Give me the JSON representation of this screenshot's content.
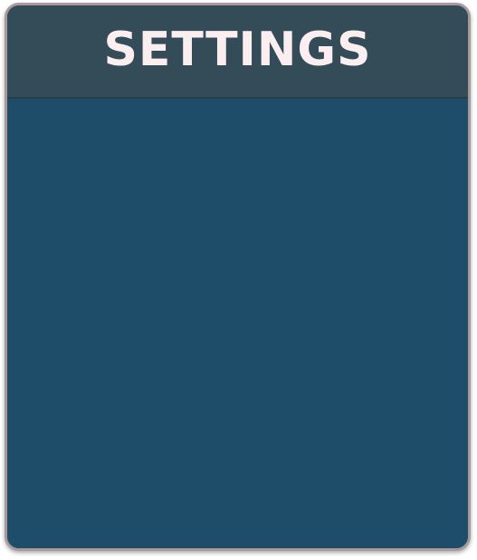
{
  "settings_panel": {
    "title": "SETTINGS"
  },
  "colors": {
    "header_background": "#344b58",
    "body_background": "#1e4d69",
    "border": "#a9999c",
    "title_text": "#fbeef0"
  }
}
